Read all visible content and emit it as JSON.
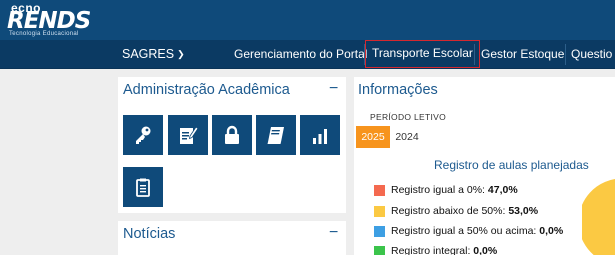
{
  "logo": {
    "prefix": "ecno",
    "main": "RENDS",
    "tagline": "Tecnologia Educacional"
  },
  "nav": {
    "sagres": "SAGRES",
    "items": [
      {
        "label": "Gerenciamento do Portal"
      },
      {
        "label": "Transporte Escolar",
        "active": true
      },
      {
        "label": "Gestor Estoque"
      },
      {
        "label": "Questio"
      }
    ]
  },
  "admin": {
    "title": "Administração Acadêmica",
    "collapse": "−",
    "tiles": [
      "key-icon",
      "edit-document-icon",
      "lock-icon",
      "book-icon",
      "bar-chart-icon",
      "clipboard-icon"
    ]
  },
  "news": {
    "title": "Notícias",
    "collapse": "−"
  },
  "info": {
    "title": "Informações",
    "period_label": "PERÍODO LETIVO",
    "tabs": [
      "2025",
      "2024"
    ],
    "selected_tab": "2025",
    "chart_title": "Registro de aulas planejadas",
    "legend": [
      {
        "label": "Registro igual a 0%: ",
        "value": "47,0%",
        "color": "#f4694f"
      },
      {
        "label": "Registro abaixo de 50%: ",
        "value": "53,0%",
        "color": "#fbc943"
      },
      {
        "label": "Registro igual a 50% ou acima: ",
        "value": "0,0%",
        "color": "#3d9fe3"
      },
      {
        "label": "Registro integral: ",
        "value": "0,0%",
        "color": "#3bc44b"
      }
    ]
  },
  "chart_data": {
    "type": "pie",
    "title": "Registro de aulas planejadas",
    "categories": [
      "Registro igual a 0%",
      "Registro abaixo de 50%",
      "Registro igual a 50% ou acima",
      "Registro integral"
    ],
    "values": [
      47.0,
      53.0,
      0.0,
      0.0
    ],
    "colors": [
      "#f4694f",
      "#fbc943",
      "#3d9fe3",
      "#3bc44b"
    ]
  }
}
